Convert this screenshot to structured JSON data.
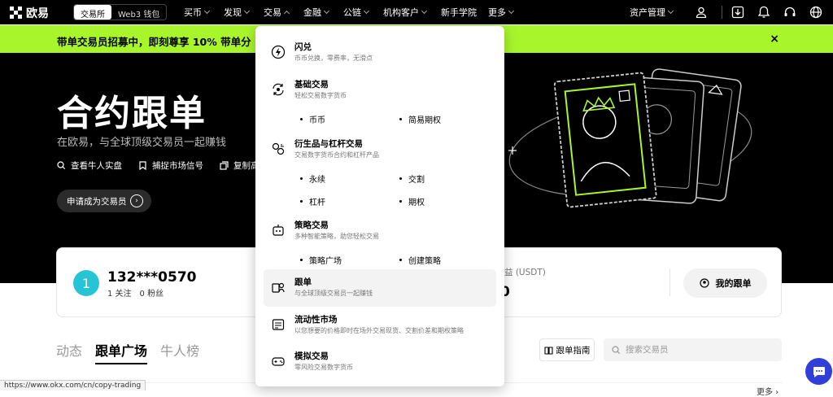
{
  "nav": {
    "brand": "欧易",
    "seg_exchange": "交易所",
    "seg_web3": "Web3 钱包",
    "items": [
      "买币",
      "发现",
      "交易",
      "金融",
      "公链",
      "机构客户",
      "新手学院",
      "更多"
    ],
    "asset": "资产管理"
  },
  "banner": {
    "text": "带单交易员招募中，即刻尊享 10% 带单分",
    "close": "×"
  },
  "hero": {
    "title": "合约跟单",
    "subtitle": "在欧易，与全球顶级交易员一起赚钱",
    "link1": "查看牛人实盘",
    "link2": "捕捉市场信号",
    "link3": "复制高",
    "apply": "申请成为交易员"
  },
  "user": {
    "avatar": "1",
    "name": "132***0570",
    "following": "1 关注",
    "followers": "0 粉丝",
    "pnl_label": "益 (USDT)",
    "pnl_value": "0",
    "my_copy": "我的跟单"
  },
  "tabs": [
    "动态",
    "跟单广场",
    "牛人榜"
  ],
  "tools": {
    "guide": "跟单指南",
    "search_placeholder": "搜索交易员"
  },
  "footer": {
    "more": "更多",
    "status_url": "https://www.okx.com/cn/copy-trading"
  },
  "dropdown": {
    "flash": {
      "title": "闪兑",
      "desc": "币币兑换，零费率，无滑点"
    },
    "basic": {
      "title": "基础交易",
      "desc": "轻松交易数字货币",
      "subs": [
        "币币",
        "简易期权"
      ]
    },
    "deriv": {
      "title": "衍生品与杠杆交易",
      "desc": "交易数字货币合约和杠杆产品",
      "subs": [
        "永续",
        "交割",
        "杠杆",
        "期权"
      ]
    },
    "strategy": {
      "title": "策略交易",
      "desc": "多种智能策略，助您轻松交易",
      "subs": [
        "策略广场",
        "创建策略"
      ]
    },
    "copy": {
      "title": "跟单",
      "desc": "与全球顶级交易员一起赚钱"
    },
    "liquidity": {
      "title": "流动性市场",
      "desc": "以您想要的价格即时在场外交易现货、交割价差和期权策略"
    },
    "demo": {
      "title": "模拟交易",
      "desc": "零风险交易数字货币"
    }
  },
  "colors": {
    "accent": "#a8f52c",
    "avatar": "#27c4d6",
    "chat": "#2f3fd8"
  }
}
